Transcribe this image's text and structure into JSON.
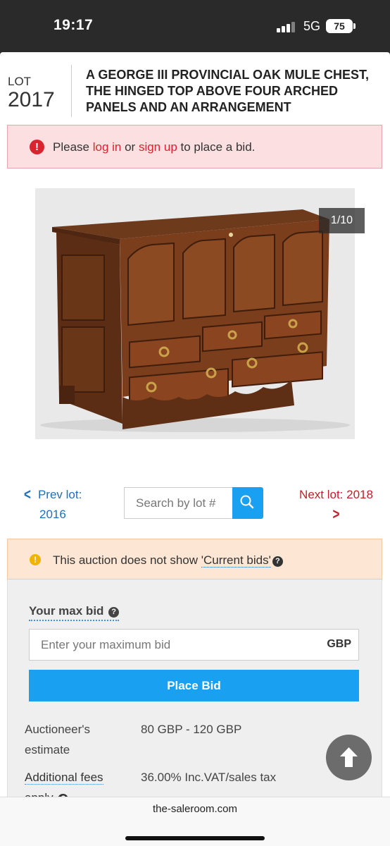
{
  "status_bar": {
    "time": "19:17",
    "network": "5G",
    "battery": "75"
  },
  "lot": {
    "label": "LOT",
    "number": "2017",
    "title": "A GEORGE III PROVINCIAL OAK MULE CHEST, THE HINGED TOP ABOVE FOUR ARCHED PANELS AND AN ARRANGEMENT"
  },
  "login_alert": {
    "icon": "exclamation-circle-icon",
    "prefix": "Please",
    "login_link": "log in",
    "middle": "or",
    "signup_link": "sign up",
    "suffix": "to place a bid."
  },
  "gallery": {
    "counter": "1/10"
  },
  "navigation": {
    "prev_label": "Prev lot:",
    "prev_number": "2016",
    "search_placeholder": "Search by lot #",
    "next_label": "Next lot: 2018"
  },
  "info_alert": {
    "icon": "info-circle-icon",
    "text": "This auction does not show ",
    "link": "'Current bids'"
  },
  "bid": {
    "max_bid_label": "Your max bid",
    "input_placeholder": "Enter your maximum bid",
    "currency": "GBP",
    "place_bid_label": "Place Bid"
  },
  "details": {
    "estimate_label_line1": "Auctioneer's",
    "estimate_label_line2": "estimate",
    "estimate_value": "80 GBP - 120 GBP",
    "fees_label_line1": "Additional fees",
    "fees_label_line2": "apply",
    "fees_value": "36.00% Inc.VAT/sales tax"
  },
  "browser": {
    "url": "the-saleroom.com"
  },
  "colors": {
    "accent_blue": "#1aa0f0",
    "link_red": "#d9232f",
    "alert_red_bg": "#fbdfe1",
    "alert_orange_bg": "#fde7d4"
  }
}
